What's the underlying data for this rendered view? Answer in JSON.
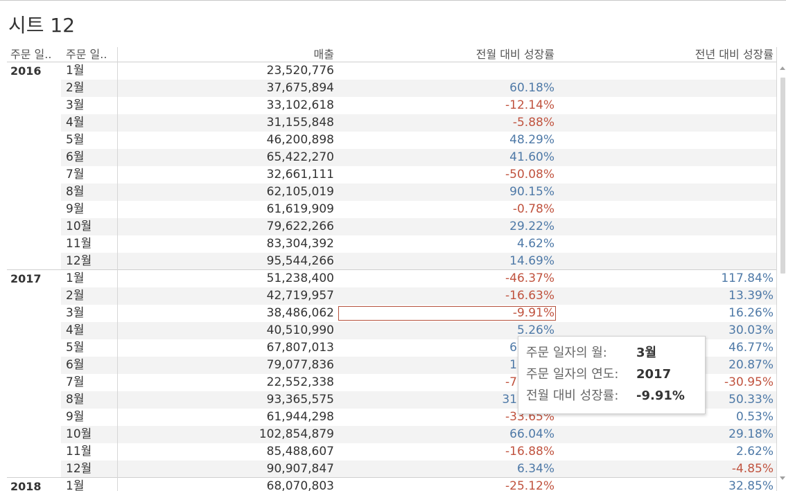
{
  "title": "시트 12",
  "colors": {
    "positive": "#4e79a7",
    "negative": "#c0533f",
    "selection": "#b5513c"
  },
  "scrollbar": {
    "up_icon": "scroll-up-icon",
    "down_icon": "scroll-down-icon"
  },
  "table": {
    "headers": {
      "year": "주문 일..",
      "month": "주문 일..",
      "sales": "매출",
      "mom": "전월 대비 성장률",
      "yoy": "전년 대비 성장률"
    },
    "groups": [
      {
        "year": "2016",
        "rows": [
          {
            "month": "1월",
            "sales": "23,520,776"
          },
          {
            "month": "2월",
            "sales": "37,675,894",
            "mom": "60.18%"
          },
          {
            "month": "3월",
            "sales": "33,102,618",
            "mom": "-12.14%"
          },
          {
            "month": "4월",
            "sales": "31,155,848",
            "mom": "-5.88%"
          },
          {
            "month": "5월",
            "sales": "46,200,898",
            "mom": "48.29%"
          },
          {
            "month": "6월",
            "sales": "65,422,270",
            "mom": "41.60%"
          },
          {
            "month": "7월",
            "sales": "32,661,111",
            "mom": "-50.08%"
          },
          {
            "month": "8월",
            "sales": "62,105,019",
            "mom": "90.15%"
          },
          {
            "month": "9월",
            "sales": "61,619,909",
            "mom": "-0.78%"
          },
          {
            "month": "10월",
            "sales": "79,622,266",
            "mom": "29.22%"
          },
          {
            "month": "11월",
            "sales": "83,304,392",
            "mom": "4.62%"
          },
          {
            "month": "12월",
            "sales": "95,544,266",
            "mom": "14.69%"
          }
        ]
      },
      {
        "year": "2017",
        "rows": [
          {
            "month": "1월",
            "sales": "51,238,400",
            "mom": "-46.37%",
            "yoy": "117.84%"
          },
          {
            "month": "2월",
            "sales": "42,719,957",
            "mom": "-16.63%",
            "yoy": "13.39%"
          },
          {
            "month": "3월",
            "sales": "38,486,062",
            "mom": "-9.91%",
            "yoy": "16.26%",
            "mom_selected": true
          },
          {
            "month": "4월",
            "sales": "40,510,990",
            "mom": "5.26%",
            "yoy": "30.03%"
          },
          {
            "month": "5월",
            "sales": "67,807,013",
            "mom": "6",
            "yoy": "46.77%"
          },
          {
            "month": "6월",
            "sales": "79,077,836",
            "mom": "1",
            "yoy": "20.87%"
          },
          {
            "month": "7월",
            "sales": "22,552,338",
            "mom": "-7",
            "yoy": "-30.95%"
          },
          {
            "month": "8월",
            "sales": "93,365,575",
            "mom": "31",
            "yoy": "50.33%"
          },
          {
            "month": "9월",
            "sales": "61,944,298",
            "mom": "-33.65%",
            "yoy": "0.53%"
          },
          {
            "month": "10월",
            "sales": "102,854,879",
            "mom": "66.04%",
            "yoy": "29.18%"
          },
          {
            "month": "11월",
            "sales": "85,488,607",
            "mom": "-16.88%",
            "yoy": "2.62%"
          },
          {
            "month": "12월",
            "sales": "90,907,847",
            "mom": "6.34%",
            "yoy": "-4.85%"
          }
        ]
      },
      {
        "year": "2018",
        "rows": [
          {
            "month": "1월",
            "sales": "68,070,803",
            "mom": "-25.12%",
            "yoy": "32.85%"
          }
        ]
      }
    ]
  },
  "tooltip": {
    "rows": [
      {
        "label": "주문 일자의 월:",
        "value": "3월"
      },
      {
        "label": "주문 일자의 연도:",
        "value": "2017"
      },
      {
        "label": "전월 대비 성장률:",
        "value": "-9.91%"
      }
    ]
  }
}
